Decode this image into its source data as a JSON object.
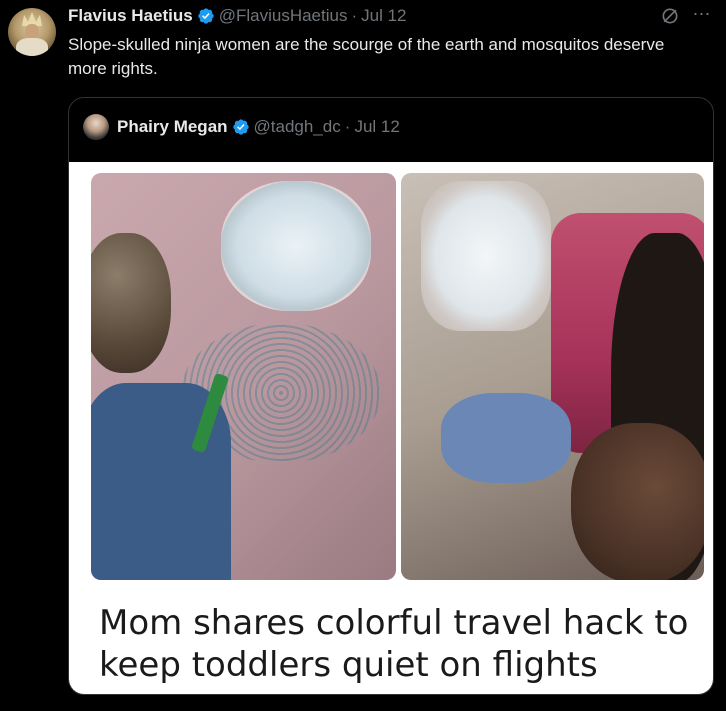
{
  "tweet": {
    "author_name": "Flavius Haetius",
    "handle": "@FlaviusHaetius",
    "separator": "·",
    "date": "Jul 12",
    "text": "Slope-skulled ninja women are the scourge of the earth and mosquitos deserve more rights."
  },
  "quoted_tweet": {
    "author_name": "Phairy Megan",
    "handle": "@tadgh_dc",
    "separator": "·",
    "date": "Jul 12",
    "media_caption": "Mom shares colorful travel hack to keep toddlers quiet on flights"
  },
  "icons": {
    "verified": "verified-badge-icon",
    "grok": "grok-icon",
    "more": "more-icon"
  },
  "colors": {
    "background": "#000000",
    "text_primary": "#e7e9ea",
    "text_secondary": "#71767b",
    "verified_blue": "#1d9bf0",
    "border": "#2f3336"
  }
}
